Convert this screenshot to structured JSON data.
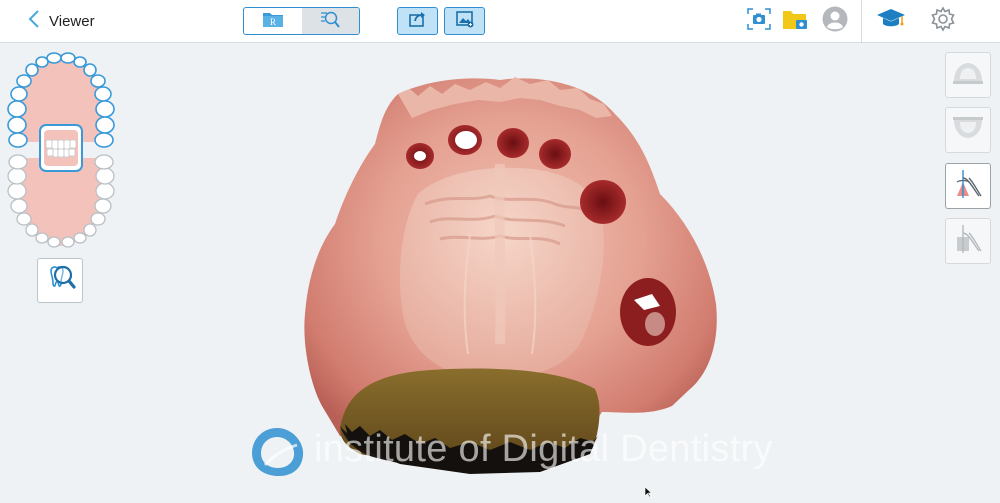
{
  "header": {
    "back_label": "Viewer"
  },
  "view_toggle": {
    "options": [
      {
        "icon": "restorative-folder-icon",
        "letter": "R",
        "selected": false
      },
      {
        "icon": "magnifier-view-icon",
        "selected": true
      }
    ]
  },
  "toolbar": {
    "share_icon": "share-export-icon",
    "gallery_icon": "image-gallery-icon"
  },
  "right_icons": [
    "camera-capture-icon",
    "patient-folder-icon",
    "user-avatar-icon",
    "education-icon",
    "settings-icon"
  ],
  "side_tools": [
    {
      "icon": "upper-jaw-view-icon",
      "selected": false
    },
    {
      "icon": "lower-jaw-view-icon",
      "selected": false
    },
    {
      "icon": "margin-line-tool-icon",
      "selected": true
    },
    {
      "icon": "die-trim-tool-icon",
      "selected": false
    }
  ],
  "jaw_navigator": {
    "upper_teeth": 16,
    "lower_teeth": 16,
    "center_view": "bite-view"
  },
  "watermark": {
    "text": "institute of Digital Dentistry"
  },
  "colors": {
    "accent": "#2f8fd0",
    "button_fill": "#bfe2f7",
    "background": "#eef2f4",
    "tooth_outline": "#3a9ad9",
    "gum_fill": "#f3c2bb",
    "education": "#1d7fc2",
    "folder": "#f2c818"
  }
}
